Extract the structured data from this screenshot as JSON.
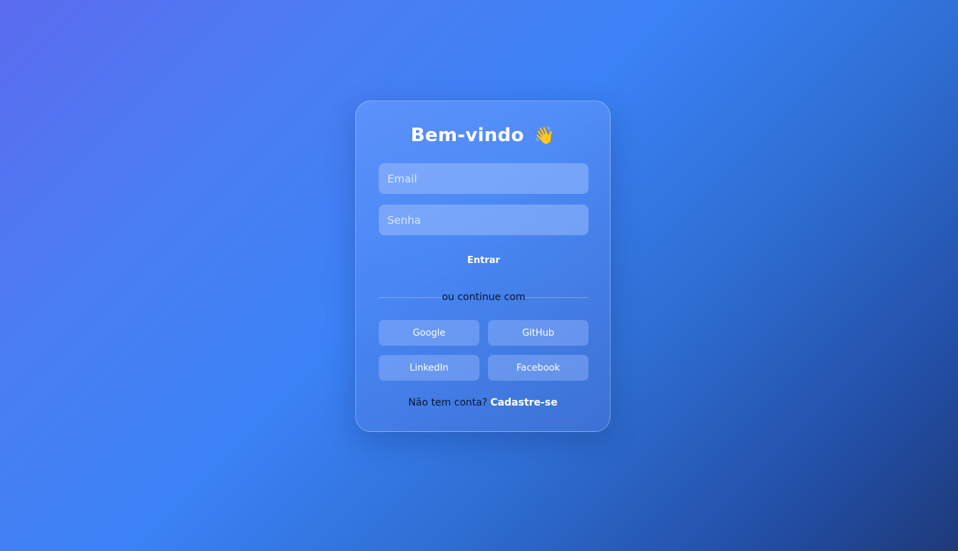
{
  "login": {
    "title": "Bem-vindo",
    "title_emoji": "👋",
    "email_placeholder": "Email",
    "password_placeholder": "Senha",
    "submit_label": "Entrar",
    "divider_text": "ou continue com",
    "social": {
      "google": "Google",
      "github": "GitHub",
      "linkedin": "LinkedIn",
      "facebook": "Facebook"
    },
    "signup_prompt": "Não tem conta?",
    "signup_link": "Cadastre-se"
  },
  "colors": {
    "background_start": "#5b6cf0",
    "background_mid": "#3b82f6",
    "background_end": "#1e3a7a",
    "text_dark": "#0b1733",
    "text_light": "#ffffff"
  }
}
